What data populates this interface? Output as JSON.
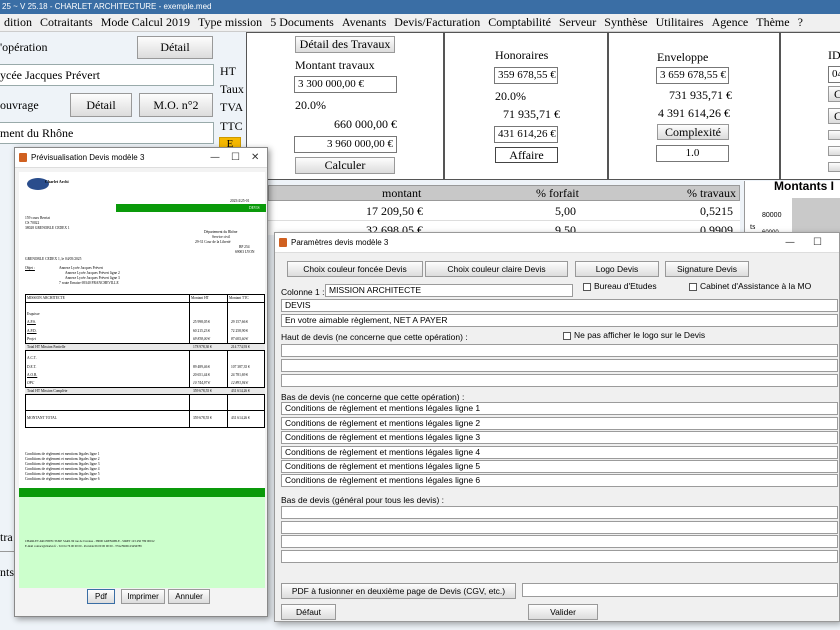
{
  "window": {
    "title": "25 ~ V 25.18 - CHARLET ARCHITECTURE - exemple.med"
  },
  "menu": [
    "dition",
    "Cotraitants",
    "Mode Calcul 2019",
    "Type mission",
    "5 Documents",
    "Avenants",
    "Devis/Facturation",
    "Comptabilité",
    "Serveur",
    "Synthèse",
    "Utilitaires",
    "Agence",
    "Thème",
    "?"
  ],
  "left": {
    "operation_label": "'opération",
    "detail_btn": "Détail",
    "operation_value": "ycée Jacques Prévert",
    "ouvrage_label": "ouvrage",
    "ouvrage_detail_btn": "Détail",
    "mo_btn": "M.O. n°2",
    "ouvrage_value": "ment du Rhône"
  },
  "labels": {
    "ht": "HT",
    "taux": "Taux",
    "tva": "TVA",
    "ttc": "TTC",
    "e": "E"
  },
  "travaux": {
    "detail_btn": "Détail des Travaux",
    "title": "Montant travaux",
    "ht": "3 300 000,00 €",
    "taux": "20.0%",
    "tva": "660 000,00 €",
    "ttc": "3 960 000,00 €",
    "calc_btn": "Calculer"
  },
  "honoraires": {
    "title": "Honoraires",
    "ht": "359 678,55 €",
    "taux": "20.0%",
    "tva": "71 935,71 €",
    "ttc": "431 614,26 €",
    "affaire_btn": "Affaire"
  },
  "enveloppe": {
    "title": "Enveloppe",
    "ht": "3 659 678,55 €",
    "tva": "731 935,71 €",
    "ttc": "4 391 614,26 €",
    "complexite_btn": "Complexité",
    "complexite_val": "1.0"
  },
  "far_right": {
    "id_label": "ID",
    "id_val": "04",
    "b1": "C",
    "b2": "C"
  },
  "table": {
    "headers": [
      "montant",
      "% forfait",
      "% travaux"
    ],
    "rows": [
      [
        "17 209,50 €",
        "5,00",
        "0,5215"
      ],
      [
        "32 698,05 €",
        "9,50",
        "0,9909"
      ]
    ]
  },
  "chart_box": {
    "title": "Montants I",
    "tick": "80000",
    "tick2": "60000",
    "ylabel": "ts"
  },
  "left_peek": {
    "tra": "tra",
    "nts": "nts"
  },
  "preview": {
    "title": "Prévisualisation Devis modèle 3",
    "logo_text": "Charlet Archi",
    "ref": "2025/4/25-01",
    "devis_band": "DEVIS",
    "sender": [
      "159 cours Berriat",
      "CS 70022",
      "38028 GRENOBLE CEDEX 1"
    ],
    "recipient": [
      "Département du Rhône",
      "Service civil",
      "29-31 Cour de la Liberté",
      "BP 254",
      "69003 LYON"
    ],
    "date_line": "GRENOBLE CEDEX 1, le 04/05/2025",
    "objet_label": "Objet :",
    "objet_lines": [
      "Annexe Lycée Jacques Prévert",
      "Annexe Lycée Jacques Prévert ligne 2",
      "Annexe Lycée Jacques Prévert ligne 3",
      "7 route Ernaise 69340 FRANCHEVILLE"
    ],
    "table_headers": [
      "MISSION ARCHITECTE",
      "Montant HT",
      "Montant TTC"
    ],
    "rows": [
      [
        "Esquisse",
        "",
        ""
      ],
      [
        "A.P.S.",
        "25 998,05 €",
        "29 157,66 €"
      ],
      [
        "A.P.D.",
        "60 215,23 €",
        "72 258,90 €"
      ],
      [
        "Projet",
        "69 838,00 €",
        "87 605,60 €"
      ],
      [
        "Total HT Mission Partielle",
        "178 978,30 €",
        "214 774,93 €"
      ],
      [
        "A.C.T.",
        "",
        ""
      ],
      [
        "D.E.T.",
        "89 489,46 €",
        "107 387,35 €"
      ],
      [
        "A.O.R.",
        "20 651,44 €",
        "24 781,69 €"
      ],
      [
        "OPC",
        "10 744,97 €",
        "12 893,94 €"
      ],
      [
        "Total HT Mission Complète",
        "359 678,55 €",
        "431 614,26 €"
      ],
      [
        "MONTANT TOTAL",
        "359 678,55 €",
        "431 614,26 €"
      ]
    ],
    "conditions": [
      "Conditions de règlement et mentions légales ligne 1",
      "Conditions de règlement et mentions légales ligne 2",
      "Conditions de règlement et mentions légales ligne 3",
      "Conditions de règlement et mentions légales ligne 4",
      "Conditions de règlement et mentions légales ligne 5",
      "Conditions de règlement et mentions légales ligne 6"
    ],
    "footer": [
      "CHARLET ARCHITECTURE SARL 99 rue de l'avenue - 38000 GRENOBLE - SIRET 123 456 789 00012",
      "E-mail contact@charlet.fr - Tél 04 76 00 00 00 - Portable 06 00 00 00 00 - TVA FR00123456789"
    ],
    "btn_pdf": "Pdf",
    "btn_print": "Imprimer",
    "btn_cancel": "Annuler"
  },
  "params": {
    "title": "Paramètres devis modèle 3",
    "btn_dark": "Choix couleur foncée Devis",
    "btn_light": "Choix couleur claire Devis",
    "btn_logo": "Logo Devis",
    "btn_signature": "Signature Devis",
    "colonne_label": "Colonne 1 :",
    "colonne_value": "MISSION ARCHITECTE",
    "chk_bureau": "Bureau d'Etudes",
    "chk_cabinet": "Cabinet d'Assistance à la MO",
    "devis_value": "DEVIS",
    "reglement_value": "En votre aimable règlement, NET A PAYER",
    "haut_label": "Haut de devis (ne concerne que cette opération) :",
    "chk_logo": "Ne pas afficher le logo sur le Devis",
    "bas_label": "Bas de devis  (ne concerne que cette opération) :",
    "bas_lines": [
      "Conditions de règlement et mentions légales ligne 1",
      "Conditions de règlement et mentions légales ligne 2",
      "Conditions de règlement et mentions légales ligne 3",
      "Conditions de règlement et mentions légales ligne 4",
      "Conditions de règlement et mentions légales ligne 5",
      "Conditions de règlement et mentions légales ligne 6"
    ],
    "bas_general_label": "Bas de devis  (général pour tous les devis) :",
    "btn_pdf_merge": "PDF à fusionner en deuxième page de Devis (CGV, etc.)",
    "btn_default": "Défaut",
    "btn_validate": "Valider"
  },
  "colors": {
    "green_band": "#0a9a0a",
    "light_green": "#ccffcc",
    "accent_orange": "#f5b800"
  }
}
